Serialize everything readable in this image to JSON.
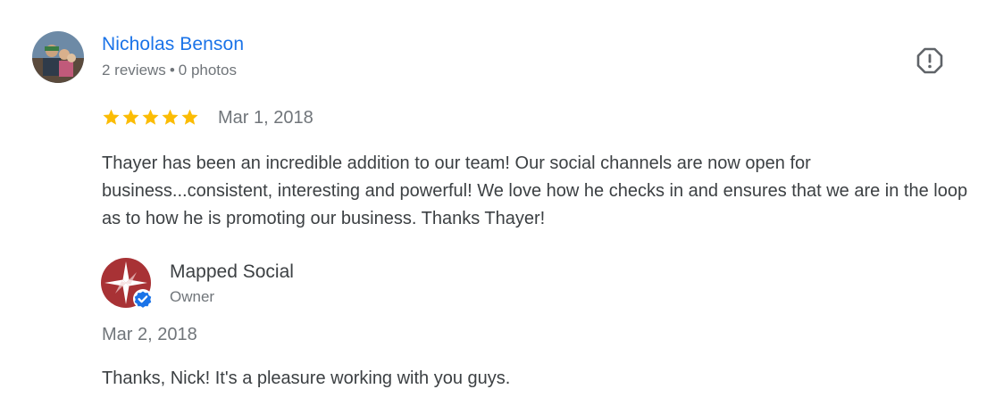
{
  "review": {
    "reviewer": {
      "name": "Nicholas Benson",
      "reviews_count": "2 reviews",
      "separator": "•",
      "photos_count": "0 photos",
      "avatar": "profile-photo"
    },
    "rating": {
      "value": 5,
      "max": 5,
      "color": "#fbbc04"
    },
    "date": "Mar 1, 2018",
    "text": "Thayer has been an incredible addition to our team! Our social channels are now open for business...consistent, interesting and powerful! We love how he checks in and ensures that we are in the loop as to how he is promoting our business. Thanks Thayer!",
    "report_icon": "report-flag-icon"
  },
  "owner_response": {
    "name": "Mapped Social",
    "role": "Owner",
    "logo_color": "#a83235",
    "verified_badge_color": "#1a73e8",
    "date": "Mar 2, 2018",
    "text": "Thanks, Nick! It's a pleasure working with you guys."
  }
}
